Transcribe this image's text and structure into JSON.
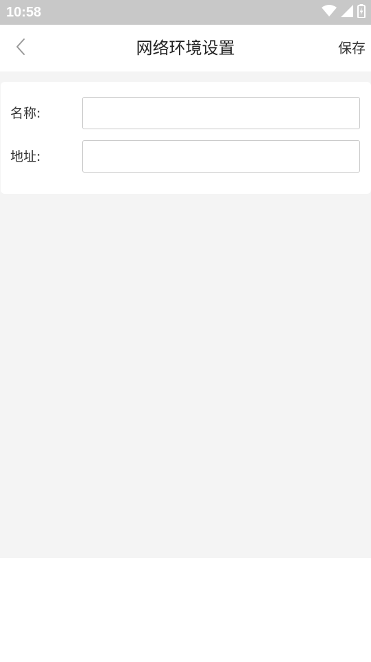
{
  "status_bar": {
    "time": "10:58",
    "icons": [
      "wifi-icon",
      "cellular-signal-icon",
      "battery-charging-icon"
    ]
  },
  "app_bar": {
    "back_icon": "chevron-left-icon",
    "title": "网络环境设置",
    "save_label": "保存"
  },
  "form": {
    "name_label": "名称:",
    "name_value": "",
    "address_label": "地址:",
    "address_value": ""
  },
  "colors": {
    "status_bar_bg": "#c8c8c8",
    "content_bg": "#f4f4f4",
    "input_border": "#c9c9c9"
  }
}
